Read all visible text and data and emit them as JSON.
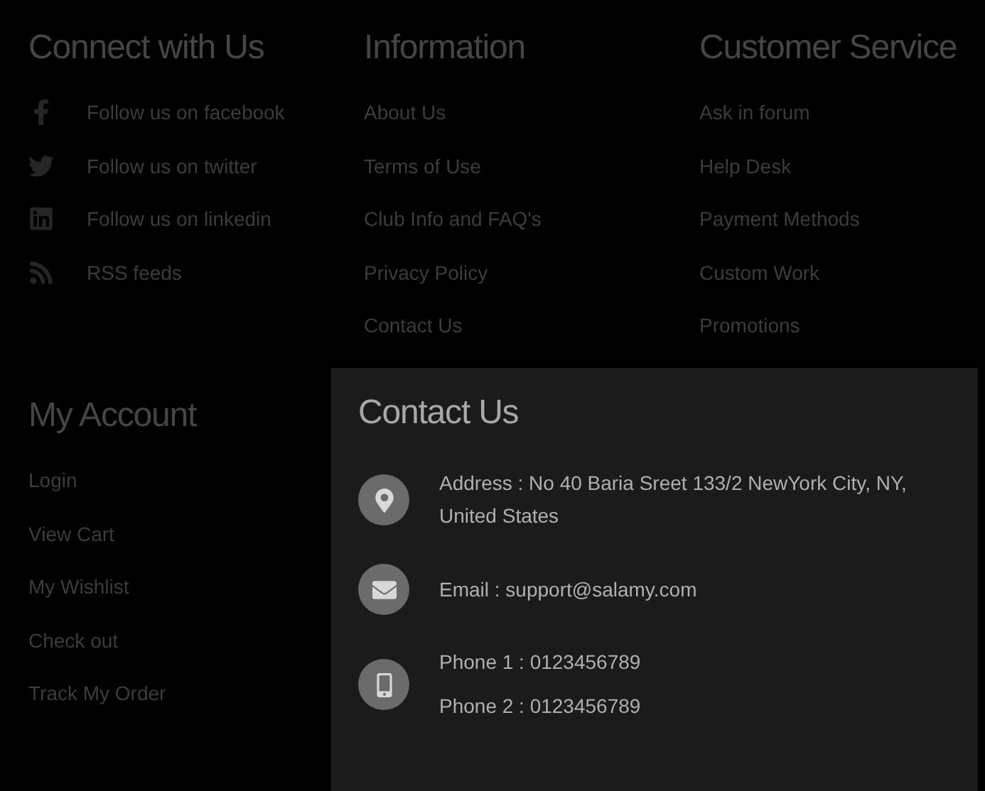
{
  "connect": {
    "title": "Connect with Us",
    "items": [
      {
        "kind": "facebook",
        "label": "Follow us on facebook"
      },
      {
        "kind": "twitter",
        "label": "Follow us on twitter"
      },
      {
        "kind": "linkedin",
        "label": "Follow us on linkedin"
      },
      {
        "kind": "rss",
        "label": "RSS feeds"
      }
    ]
  },
  "information": {
    "title": "Information",
    "links": [
      "About Us",
      "Terms of Use",
      "Club Info and FAQ's",
      "Privacy Policy",
      "Contact Us"
    ]
  },
  "customer_service": {
    "title": "Customer Service",
    "links": [
      "Ask in forum",
      "Help Desk",
      "Payment Methods",
      "Custom Work",
      "Promotions"
    ]
  },
  "my_account": {
    "title": "My Account",
    "links": [
      "Login",
      "View Cart",
      "My Wishlist",
      "Check out",
      "Track My Order"
    ]
  },
  "contact": {
    "title": "Contact Us",
    "items": [
      {
        "kind": "address",
        "lines": [
          "Address : No 40 Baria Sreet 133/2 NewYork City, NY, United States"
        ]
      },
      {
        "kind": "email",
        "lines": [
          "Email : support@salamy.com"
        ]
      },
      {
        "kind": "phone",
        "lines": [
          "Phone 1 : 0123456789",
          "Phone 2 : 0123456789"
        ]
      }
    ]
  }
}
